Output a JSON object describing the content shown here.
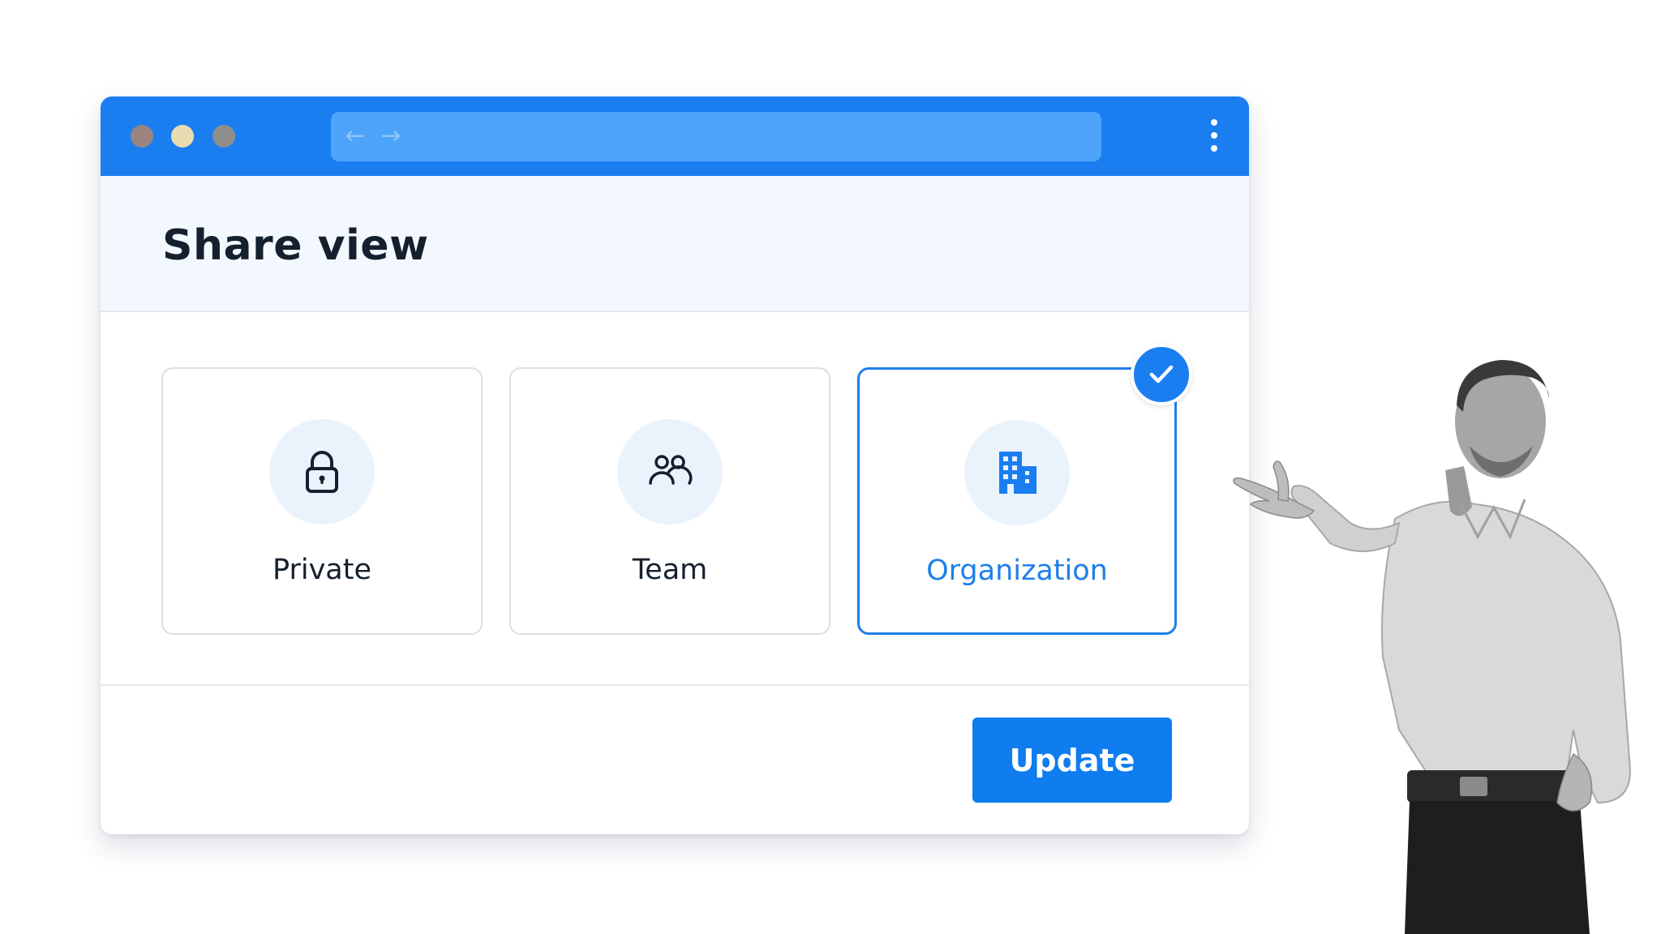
{
  "window": {
    "nav_back": "←",
    "nav_forward": "→",
    "url": ""
  },
  "dialog": {
    "title": "Share view",
    "options": [
      {
        "label": "Private",
        "icon": "lock-icon",
        "selected": false
      },
      {
        "label": "Team",
        "icon": "users-icon",
        "selected": false
      },
      {
        "label": "Organization",
        "icon": "building-icon",
        "selected": true
      }
    ],
    "update_label": "Update"
  },
  "colors": {
    "accent": "#1a7ef0",
    "selected_text": "#1f7fe8",
    "header_bg": "#f3f8fe"
  }
}
